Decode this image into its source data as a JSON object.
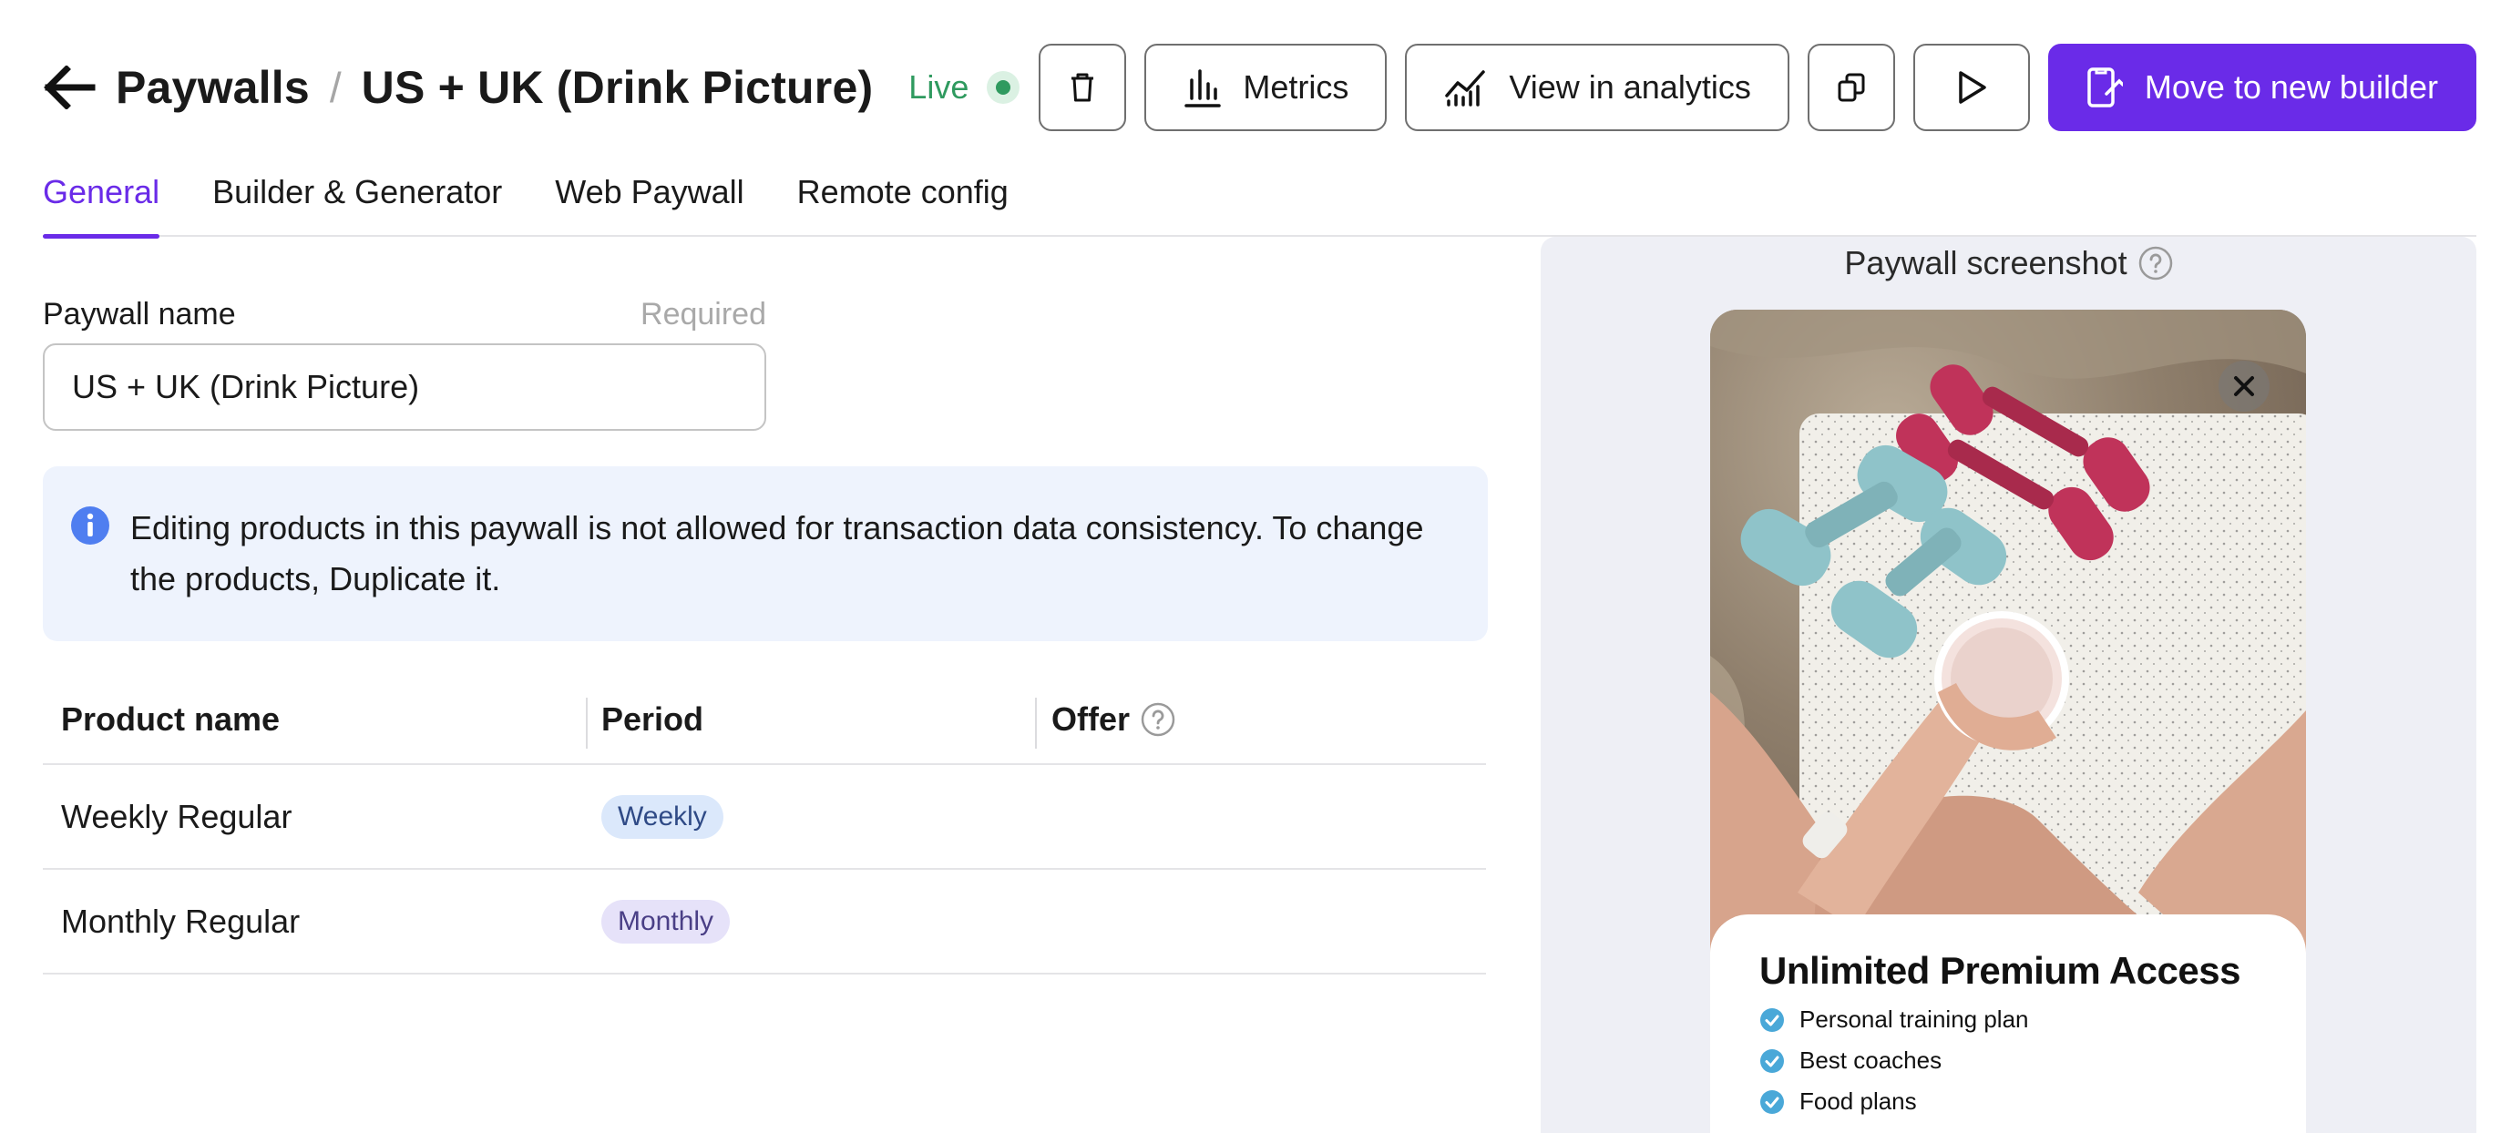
{
  "header": {
    "breadcrumb_root": "Paywalls",
    "separator": "/",
    "title": "US + UK (Drink Picture)",
    "status": "Live",
    "status_color": "#2f9a5f",
    "actions": {
      "delete_icon": "trash-icon",
      "metrics_label": "Metrics",
      "analytics_label": "View in analytics",
      "duplicate_icon": "copy-icon",
      "preview_icon": "play-icon",
      "move_label": "Move to new builder"
    }
  },
  "tabs": [
    {
      "label": "General",
      "active": true
    },
    {
      "label": "Builder & Generator",
      "active": false
    },
    {
      "label": "Web Paywall",
      "active": false
    },
    {
      "label": "Remote config",
      "active": false
    }
  ],
  "form": {
    "name_label": "Paywall name",
    "required_label": "Required",
    "name_value": "US + UK (Drink Picture)"
  },
  "info": {
    "text": "Editing products in this paywall is not allowed for transaction data consistency. To change the products, Duplicate it."
  },
  "table": {
    "headers": [
      "Product name",
      "Period",
      "Offer"
    ],
    "rows": [
      {
        "product": "Weekly Regular",
        "period": "Weekly",
        "offer": ""
      },
      {
        "product": "Monthly Regular",
        "period": "Monthly",
        "offer": ""
      }
    ]
  },
  "preview": {
    "title": "Paywall screenshot",
    "sheet_title": "Unlimited Premium Access",
    "features": [
      "Personal training plan",
      "Best coaches",
      "Food plans"
    ]
  },
  "colors": {
    "accent": "#6a2be8",
    "info_bg": "#eef3fd",
    "panel_bg": "#eeeff5"
  }
}
